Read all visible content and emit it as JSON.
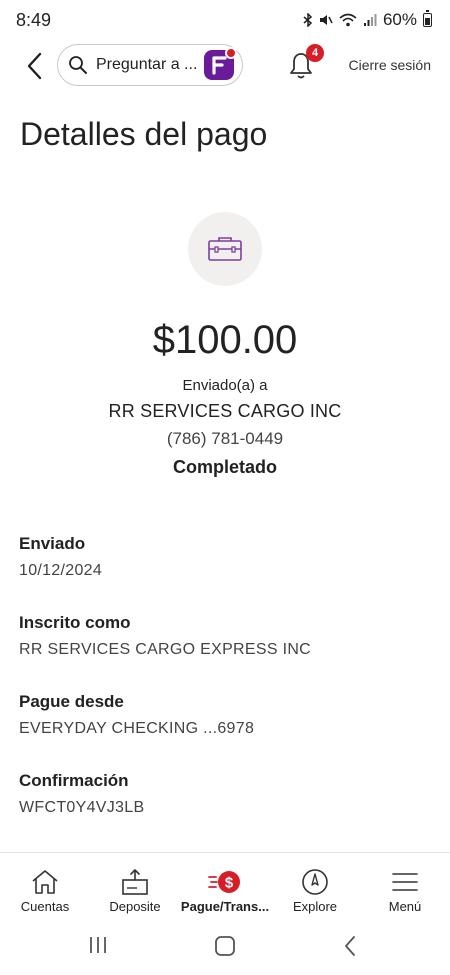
{
  "status_bar": {
    "time": "8:49",
    "battery": "60%"
  },
  "header": {
    "search_placeholder": "Preguntar a ...",
    "notification_count": "4",
    "signout_label": "Cierre sesión"
  },
  "page": {
    "title": "Detalles del pago",
    "amount": "$100.00",
    "sent_to_label": "Enviado(a) a",
    "recipient_name": "RR SERVICES CARGO INC",
    "recipient_phone": "(786) 781-0449",
    "status": "Completado"
  },
  "details": [
    {
      "label": "Enviado",
      "value": "10/12/2024"
    },
    {
      "label": "Inscrito como",
      "value": "RR SERVICES CARGO EXPRESS INC"
    },
    {
      "label": "Pague desde",
      "value": "EVERYDAY CHECKING ...6978"
    },
    {
      "label": "Confirmación",
      "value": "WFCT0Y4VJ3LB"
    }
  ],
  "bottom_nav": [
    {
      "label": "Cuentas",
      "icon": "home-icon"
    },
    {
      "label": "Deposite",
      "icon": "deposit-icon"
    },
    {
      "label": "Pague/Trans...",
      "icon": "pay-transfer-icon",
      "active": true
    },
    {
      "label": "Explore",
      "icon": "compass-icon"
    },
    {
      "label": "Menú",
      "icon": "menu-icon"
    }
  ],
  "colors": {
    "brand_red": "#d71e28",
    "brand_purple": "#6a1b9a",
    "briefcase_purple": "#7b3fa0"
  }
}
